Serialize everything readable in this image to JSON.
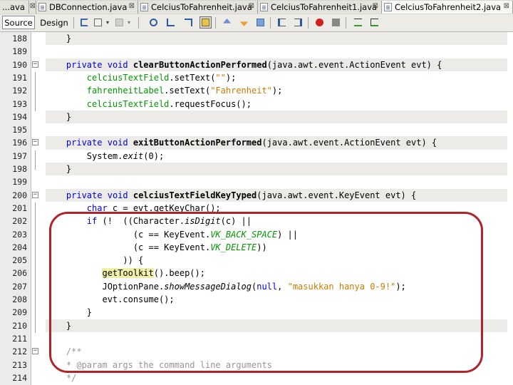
{
  "tabs": [
    {
      "label": "...ava",
      "active": false,
      "close": "⊠"
    },
    {
      "label": "DBConnection.java",
      "active": false,
      "close": "⊠"
    },
    {
      "label": "CelciusToFahrenheit.java",
      "active": false,
      "close": "⊠"
    },
    {
      "label": "CelciusToFahrenheit1.java",
      "active": false,
      "close": "⊠"
    },
    {
      "label": "CelciusToFahrenheit2.java",
      "active": true,
      "close": "⊠"
    }
  ],
  "toolbar": {
    "source_label": "Source",
    "design_label": "Design",
    "icons": [
      "last-edit-icon",
      "back-icon",
      "back-dropdown-icon",
      "forward-icon",
      "forward-dropdown-icon",
      "find-icon",
      "find-previous-icon",
      "find-next-icon",
      "toggle-highlight-icon",
      "previous-bookmark-icon",
      "next-bookmark-icon",
      "toggle-bookmark-icon",
      "shift-left-icon",
      "shift-right-icon",
      "start-macro-icon",
      "stop-macro-icon",
      "comment-icon",
      "uncomment-icon"
    ]
  },
  "editor": {
    "lines": [
      {
        "num": "188",
        "fold": "",
        "tokens": [
          [
            "plain",
            "    }"
          ]
        ]
      },
      {
        "num": "189",
        "fold": "",
        "tokens": []
      },
      {
        "num": "190",
        "fold": "−",
        "tokens": [
          [
            "plain",
            "    "
          ],
          [
            "kw",
            "private"
          ],
          [
            "plain",
            " "
          ],
          [
            "kw",
            "void"
          ],
          [
            "plain",
            " "
          ],
          [
            "mth",
            "clearButtonActionPerformed"
          ],
          [
            "plain",
            "(java.awt.event.ActionEvent evt) {"
          ]
        ]
      },
      {
        "num": "191",
        "fold": "",
        "tokens": [
          [
            "plain",
            "        "
          ],
          [
            "fld",
            "celciusTextField"
          ],
          [
            "plain",
            ".setText("
          ],
          [
            "str",
            "\"\""
          ],
          [
            "plain",
            ");"
          ]
        ]
      },
      {
        "num": "192",
        "fold": "",
        "tokens": [
          [
            "plain",
            "        "
          ],
          [
            "fld",
            "fahrenheitLabel"
          ],
          [
            "plain",
            ".setText("
          ],
          [
            "str",
            "\"Fahrenheit\""
          ],
          [
            "plain",
            ");"
          ]
        ]
      },
      {
        "num": "193",
        "fold": "",
        "tokens": [
          [
            "plain",
            "        "
          ],
          [
            "fld",
            "celciusTextField"
          ],
          [
            "plain",
            ".requestFocus();"
          ]
        ]
      },
      {
        "num": "194",
        "fold": "",
        "tokens": [
          [
            "plain",
            "    }"
          ]
        ]
      },
      {
        "num": "195",
        "fold": "",
        "tokens": []
      },
      {
        "num": "196",
        "fold": "−",
        "tokens": [
          [
            "plain",
            "    "
          ],
          [
            "kw",
            "private"
          ],
          [
            "plain",
            " "
          ],
          [
            "kw",
            "void"
          ],
          [
            "plain",
            " "
          ],
          [
            "mth",
            "exitButtonActionPerformed"
          ],
          [
            "plain",
            "(java.awt.event.ActionEvent evt) {"
          ]
        ]
      },
      {
        "num": "197",
        "fold": "",
        "tokens": [
          [
            "plain",
            "        System."
          ],
          [
            "ital",
            "exit"
          ],
          [
            "plain",
            "(0);"
          ]
        ]
      },
      {
        "num": "198",
        "fold": "",
        "tokens": [
          [
            "plain",
            "    }"
          ]
        ]
      },
      {
        "num": "199",
        "fold": "",
        "tokens": []
      },
      {
        "num": "200",
        "fold": "−",
        "tokens": [
          [
            "plain",
            "    "
          ],
          [
            "kw",
            "private"
          ],
          [
            "plain",
            " "
          ],
          [
            "kw",
            "void"
          ],
          [
            "plain",
            " "
          ],
          [
            "mth",
            "celciusTextFieldKeyTyped"
          ],
          [
            "plain",
            "(java.awt.event.KeyEvent evt) {"
          ]
        ]
      },
      {
        "num": "201",
        "fold": "",
        "tokens": [
          [
            "plain",
            "        "
          ],
          [
            "kw",
            "char"
          ],
          [
            "plain",
            " c = evt.getKeyChar();"
          ]
        ]
      },
      {
        "num": "202",
        "fold": "",
        "tokens": [
          [
            "plain",
            "        "
          ],
          [
            "kw",
            "if"
          ],
          [
            "plain",
            " (!  ((Character."
          ],
          [
            "ital",
            "isDigit"
          ],
          [
            "plain",
            "(c) ||"
          ]
        ]
      },
      {
        "num": "203",
        "fold": "",
        "tokens": [
          [
            "plain",
            "                 (c == KeyEvent."
          ],
          [
            "cst",
            "VK_BACK_SPACE"
          ],
          [
            "plain",
            ") ||"
          ]
        ]
      },
      {
        "num": "204",
        "fold": "",
        "tokens": [
          [
            "plain",
            "                 (c == KeyEvent."
          ],
          [
            "cst",
            "VK_DELETE"
          ],
          [
            "plain",
            "))"
          ]
        ]
      },
      {
        "num": "205",
        "fold": "",
        "tokens": [
          [
            "plain",
            "               )) {"
          ]
        ]
      },
      {
        "num": "206",
        "fold": "",
        "tokens": [
          [
            "plain",
            "           "
          ],
          [
            "hl",
            "getToolkit"
          ],
          [
            "plain",
            "().beep();"
          ]
        ]
      },
      {
        "num": "207",
        "fold": "",
        "tokens": [
          [
            "plain",
            "           JOptionPane."
          ],
          [
            "ital",
            "showMessageDialog"
          ],
          [
            "plain",
            "("
          ],
          [
            "kw",
            "null"
          ],
          [
            "plain",
            ", "
          ],
          [
            "str",
            "\"masukkan hanya 0-9!\""
          ],
          [
            "plain",
            ");"
          ]
        ]
      },
      {
        "num": "208",
        "fold": "",
        "tokens": [
          [
            "plain",
            "           evt.consume();"
          ]
        ]
      },
      {
        "num": "209",
        "fold": "",
        "tokens": [
          [
            "plain",
            "        }"
          ]
        ]
      },
      {
        "num": "210",
        "fold": "",
        "tokens": [
          [
            "plain",
            "    }"
          ]
        ]
      },
      {
        "num": "211",
        "fold": "",
        "tokens": []
      },
      {
        "num": "212",
        "fold": "−",
        "tokens": [
          [
            "plain",
            "    "
          ],
          [
            "cmt",
            "/**"
          ]
        ]
      },
      {
        "num": "213",
        "fold": "",
        "tokens": [
          [
            "plain",
            "    "
          ],
          [
            "cmt",
            "* @param args the command line arguments"
          ]
        ]
      },
      {
        "num": "214",
        "fold": "",
        "tokens": [
          [
            "plain",
            "    "
          ],
          [
            "cmt",
            "*/"
          ]
        ]
      }
    ],
    "highlighted_lines": [
      "188",
      "190",
      "194",
      "196",
      "198",
      "200",
      "210"
    ],
    "annotation_color": "#b2222b"
  }
}
